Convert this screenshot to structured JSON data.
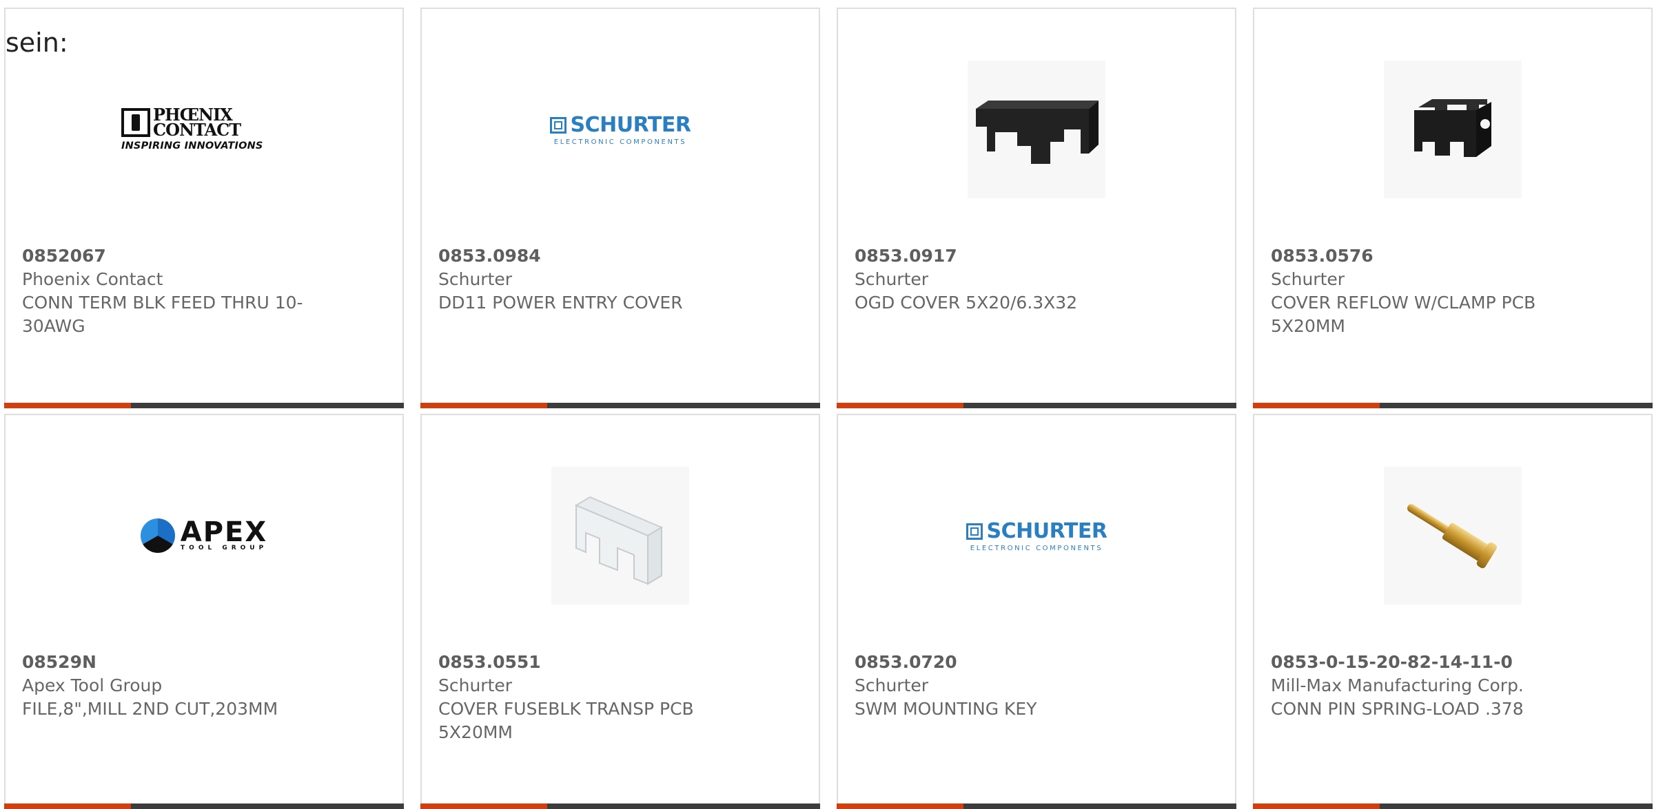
{
  "intro_text": "sein:",
  "products": [
    {
      "part": "0852067",
      "maker": "Phoenix Contact",
      "desc": "CONN TERM BLK FEED THRU 10-30AWG",
      "image": "phoenix-contact-logo",
      "logo_text": {
        "line1": "PHŒNIX",
        "line2": "CONTACT",
        "tagline": "INSPIRING INNOVATIONS"
      }
    },
    {
      "part": "0853.0984",
      "maker": "Schurter",
      "desc": "DD11 POWER ENTRY COVER",
      "image": "schurter-logo",
      "logo_text": {
        "main": "SCHURTER",
        "sub": "ELECTRONIC COMPONENTS"
      }
    },
    {
      "part": "0853.0917",
      "maker": "Schurter",
      "desc": "OGD COVER 5X20/6.3X32",
      "image": "black-fuse-cover-photo"
    },
    {
      "part": "0853.0576",
      "maker": "Schurter",
      "desc": "COVER REFLOW W/CLAMP PCB 5X20MM",
      "image": "black-clamp-cover-photo"
    },
    {
      "part": "08529N",
      "maker": "Apex Tool Group",
      "desc": "FILE,8\",MILL 2ND CUT,203MM",
      "image": "apex-tool-group-logo",
      "logo_text": {
        "main": "APEX",
        "sub": "TOOL GROUP"
      }
    },
    {
      "part": "0853.0551",
      "maker": "Schurter",
      "desc": "COVER FUSEBLK TRANSP PCB 5X20MM",
      "image": "transparent-fuse-cover-photo"
    },
    {
      "part": "0853.0720",
      "maker": "Schurter",
      "desc": "SWM MOUNTING KEY",
      "image": "schurter-logo",
      "logo_text": {
        "main": "SCHURTER",
        "sub": "ELECTRONIC COMPONENTS"
      }
    },
    {
      "part": "0853-0-15-20-82-14-11-0",
      "maker": "Mill-Max Manufacturing Corp.",
      "desc": "CONN PIN SPRING-LOAD .378",
      "image": "gold-spring-pin-photo"
    }
  ],
  "colors": {
    "accent": "#d63d0c",
    "bar": "#3c3c3c",
    "text": "#666666",
    "schurter_blue": "#2a7fc2"
  }
}
